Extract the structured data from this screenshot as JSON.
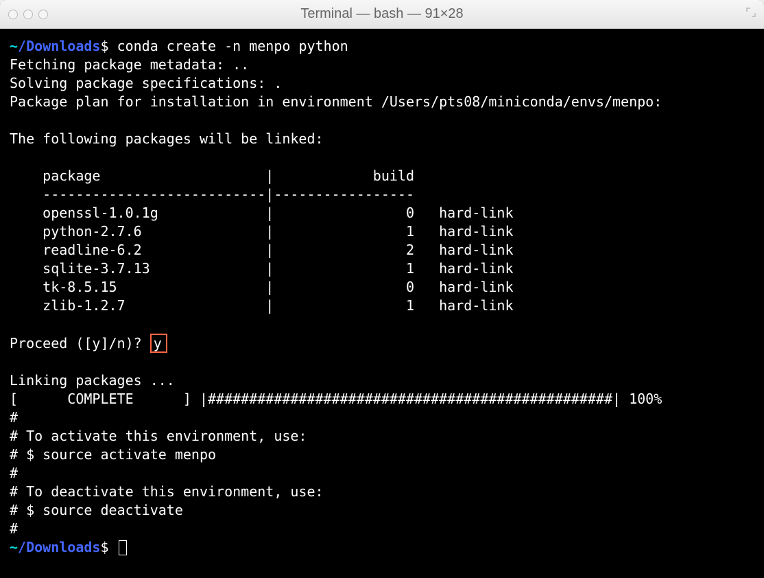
{
  "window": {
    "title": "Terminal — bash — 91×28"
  },
  "session": {
    "prompt1": {
      "tilde": "~",
      "path": "/Downloads",
      "dollar": "$",
      "command": "conda create -n menpo python"
    },
    "line_fetching": "Fetching package metadata: ..",
    "line_solving": "Solving package specifications: .",
    "line_plan": "Package plan for installation in environment /Users/pts08/miniconda/envs/menpo:",
    "line_following": "The following packages will be linked:",
    "header_row": "    package                    |            build",
    "divider_row": "    ---------------------------|-----------------",
    "packages": [
      "    openssl-1.0.1g             |                0   hard-link",
      "    python-2.7.6               |                1   hard-link",
      "    readline-6.2               |                2   hard-link",
      "    sqlite-3.7.13              |                1   hard-link",
      "    tk-8.5.15                  |                0   hard-link",
      "    zlib-1.2.7                 |                1   hard-link"
    ],
    "proceed_prompt": "Proceed ([y]/n)?",
    "proceed_answer": "y",
    "linking": "Linking packages ...",
    "progress": "[      COMPLETE      ] |#################################################| 100%",
    "comments": [
      "#",
      "# To activate this environment, use:",
      "# $ source activate menpo",
      "#",
      "# To deactivate this environment, use:",
      "# $ source deactivate",
      "#"
    ],
    "prompt2": {
      "tilde": "~",
      "path": "/Downloads",
      "dollar": "$"
    }
  }
}
